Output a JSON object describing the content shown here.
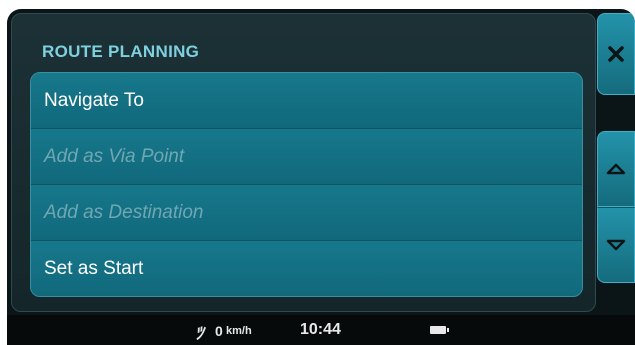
{
  "panel": {
    "title": "ROUTE PLANNING",
    "menu_items": [
      {
        "label": "Navigate To",
        "enabled": true
      },
      {
        "label": "Add as Via Point",
        "enabled": false
      },
      {
        "label": "Add as Destination",
        "enabled": false
      },
      {
        "label": "Set as Start",
        "enabled": true
      }
    ]
  },
  "side_buttons": {
    "close_icon": "close-icon",
    "up_icon": "chevron-up-icon",
    "down_icon": "chevron-down-icon"
  },
  "status_bar": {
    "speed_value": "0",
    "speed_unit": "km/h",
    "time": "10:44",
    "battery_icon": "battery-icon"
  },
  "colors": {
    "accent": "#7fd0df",
    "menu_bg": "#136c80",
    "button_bg": "#1a8198",
    "disabled_text": "#6fa7b3"
  }
}
